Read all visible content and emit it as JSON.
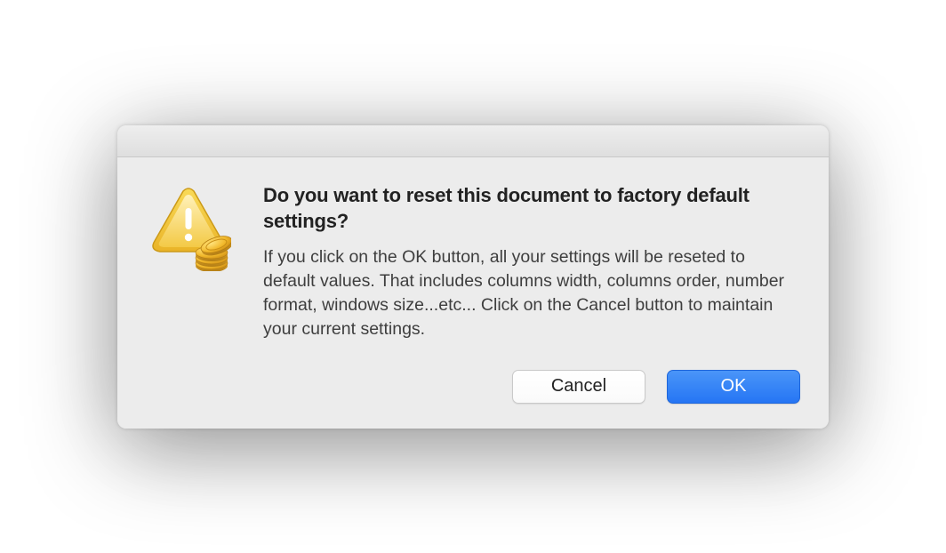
{
  "dialog": {
    "heading": "Do you want to reset this document to factory default settings?",
    "body": "If you click on the OK button, all your settings will be reseted to default values. That includes columns width, columns order, number format, windows size...etc... Click on the Cancel button to maintain your current settings.",
    "buttons": {
      "cancel": "Cancel",
      "ok": "OK"
    },
    "icon": "warning-coins-icon"
  }
}
